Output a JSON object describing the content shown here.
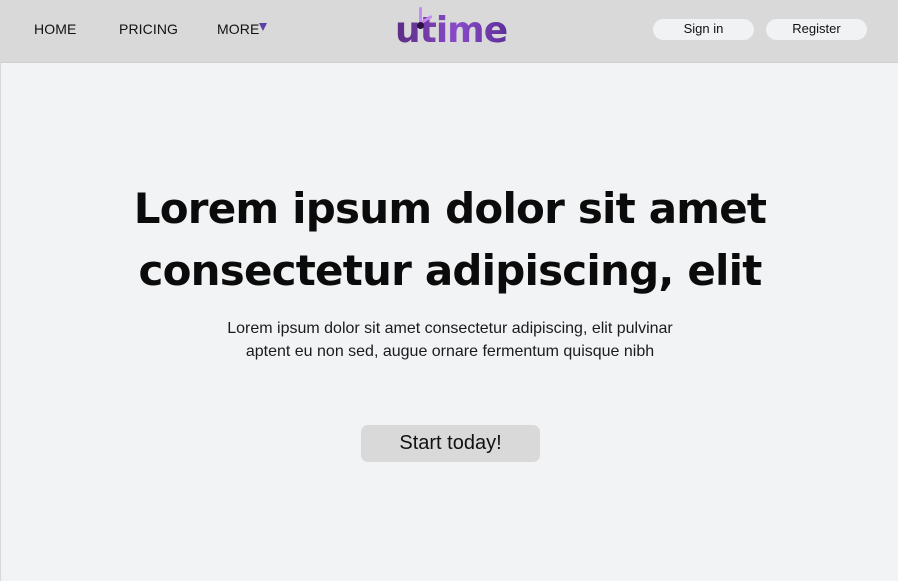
{
  "nav": {
    "home_label": "HOME",
    "pricing_label": "PRICING",
    "more_label": "MORE"
  },
  "logo": {
    "text": "utime"
  },
  "auth": {
    "signin_label": "Sign in",
    "register_label": "Register"
  },
  "hero": {
    "headline_line1": "Lorem ipsum dolor sit amet",
    "headline_line2": "consectetur adipiscing, elit",
    "subtext_line1": "Lorem ipsum dolor sit amet consectetur adipiscing, elit pulvinar",
    "subtext_line2": "aptent eu non sed, augue ornare fermentum quisque nibh",
    "cta_label": "Start today!"
  },
  "colors": {
    "nav_bg": "#d9d9d9",
    "page_bg": "#f2f3f5",
    "brand_purple": "#6b3fa8",
    "brand_light_purple": "#c48bf0",
    "caret": "#5a3fa6"
  },
  "icons": {
    "more_caret": "chevron-down-icon"
  }
}
